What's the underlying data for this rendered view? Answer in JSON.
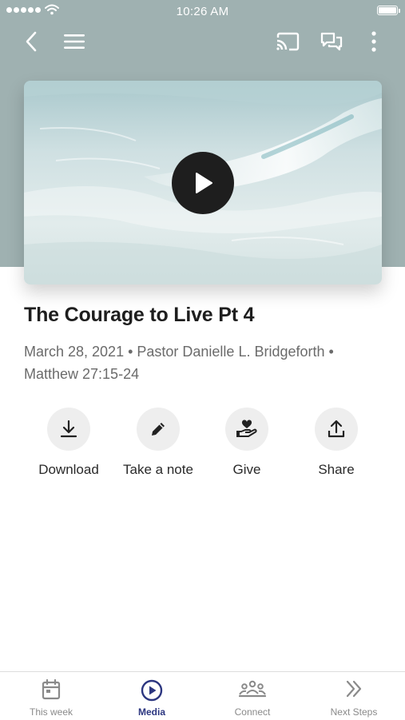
{
  "status_bar": {
    "time": "10:26 AM"
  },
  "top_bar": {
    "icons": [
      "back-icon",
      "menu-icon",
      "cast-icon",
      "chat-icon",
      "more-icon"
    ]
  },
  "media": {
    "title": "The Courage to Live Pt 4",
    "meta_line1": "March 28, 2021 • Pastor Danielle L. Bridgeforth •",
    "meta_line2": "Matthew 27:15-24"
  },
  "actions": [
    {
      "label": "Download",
      "icon": "download-icon"
    },
    {
      "label": "Take a note",
      "icon": "pencil-icon"
    },
    {
      "label": "Give",
      "icon": "give-icon"
    },
    {
      "label": "Share",
      "icon": "share-icon"
    }
  ],
  "tabs": [
    {
      "label": "This week",
      "icon": "calendar-icon",
      "active": false
    },
    {
      "label": "Media",
      "icon": "play-circle-icon",
      "active": true
    },
    {
      "label": "Connect",
      "icon": "people-icon",
      "active": false
    },
    {
      "label": "Next Steps",
      "icon": "double-chevron-icon",
      "active": false
    }
  ],
  "colors": {
    "header_bg": "#9fb1b1",
    "active_tab": "#2c3680",
    "inactive_tab": "#8a8a8a",
    "action_circle": "#eeeeee"
  }
}
